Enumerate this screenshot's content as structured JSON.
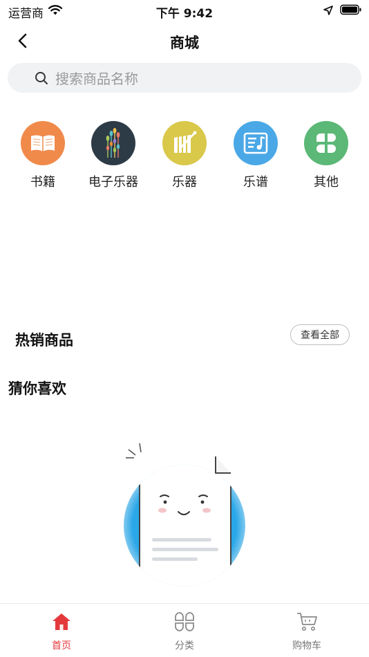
{
  "status_bar": {
    "carrier": "运营商",
    "time": "下午 9:42"
  },
  "nav": {
    "title": "商城"
  },
  "search": {
    "placeholder": "搜索商品名称"
  },
  "categories": [
    {
      "label": "书籍",
      "color": "#f08a4b",
      "icon": "book-icon"
    },
    {
      "label": "电子乐器",
      "color": "#2d3b47",
      "icon": "electronic-instrument-icon"
    },
    {
      "label": "乐器",
      "color": "#d9c84a",
      "icon": "instrument-icon"
    },
    {
      "label": "乐谱",
      "color": "#4aa8e6",
      "icon": "sheet-music-icon"
    },
    {
      "label": "其他",
      "color": "#5bb877",
      "icon": "clover-icon"
    }
  ],
  "hot": {
    "title": "热销商品",
    "view_all": "查看全部"
  },
  "guess": {
    "title": "猜你喜欢"
  },
  "tabbar": {
    "items": [
      {
        "label": "首页",
        "icon": "home-icon",
        "active": true
      },
      {
        "label": "分类",
        "icon": "category-icon",
        "active": false
      },
      {
        "label": "购物车",
        "icon": "cart-icon",
        "active": false
      }
    ]
  },
  "colors": {
    "accent": "#e4393c",
    "illustration_blue": "#2aa7e8"
  }
}
